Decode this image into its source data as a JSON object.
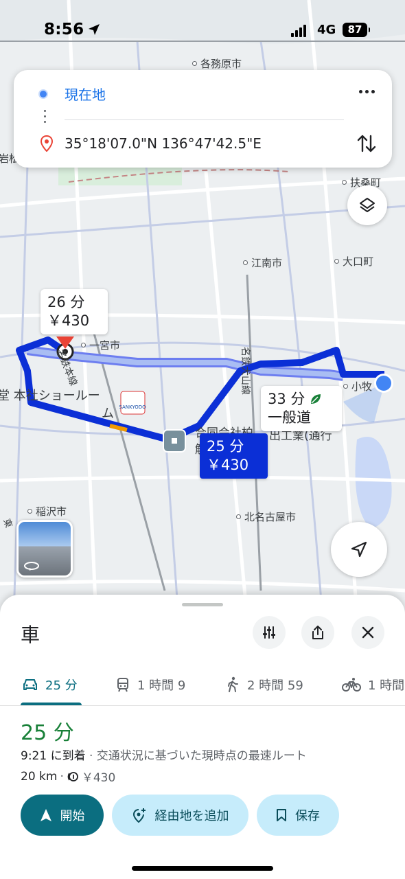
{
  "status_bar": {
    "time": "8:56",
    "network": "4G",
    "battery": "87"
  },
  "route_card": {
    "origin": "現在地",
    "destination": "35°18'07.0\"N 136°47'42.5\"E"
  },
  "map": {
    "places": {
      "kakamigahara": "各務原市",
      "fuso": "扶桑町",
      "konan": "江南市",
      "oguchi": "大口町",
      "ichinomiya": "一宮市",
      "komaki": "小牧",
      "inazawa": "稲沢市",
      "kitanagoya": "北名古屋市"
    },
    "line_labels": {
      "meitetsu_inuyama": "名鉄犬山線",
      "meitetsu_honsen": "名鉄本線",
      "cut_left_top": "岩松",
      "cut_left_bottom": "東"
    },
    "poi": {
      "showroom_line1": "堂 本社ショールー",
      "showroom_line2": "ム",
      "company_line1": "合同会社柏",
      "company_line2": "解",
      "company_suffix": "出工業(通行"
    },
    "route_labels": {
      "alt1_time": "26 分",
      "alt1_fare": "￥430",
      "alt2_time": "33 分",
      "alt2_type": "一般道",
      "best_time": "25 分",
      "best_fare": "￥430"
    }
  },
  "sheet": {
    "title": "車",
    "tabs": [
      {
        "label": "25 分",
        "icon": "car-icon"
      },
      {
        "label": "1 時間 9",
        "icon": "train-icon"
      },
      {
        "label": "2 時間 59",
        "icon": "walk-icon"
      },
      {
        "label": "1 時間",
        "icon": "bike-icon"
      }
    ],
    "duration": "25 分",
    "arrival": "9:21 に到着",
    "arrival_note": " · 交通状況に基づいた現時点の最速ルート",
    "distance": "20 km",
    "distance_sep": " · ",
    "toll": "￥430",
    "buttons": {
      "start": "開始",
      "add_stop": "経由地を追加",
      "save": "保存"
    }
  },
  "colors": {
    "route_primary": "#0b2fd6",
    "route_alt": "#a9bdf3",
    "accent_teal": "#0b6e80",
    "duration_green": "#188038"
  }
}
